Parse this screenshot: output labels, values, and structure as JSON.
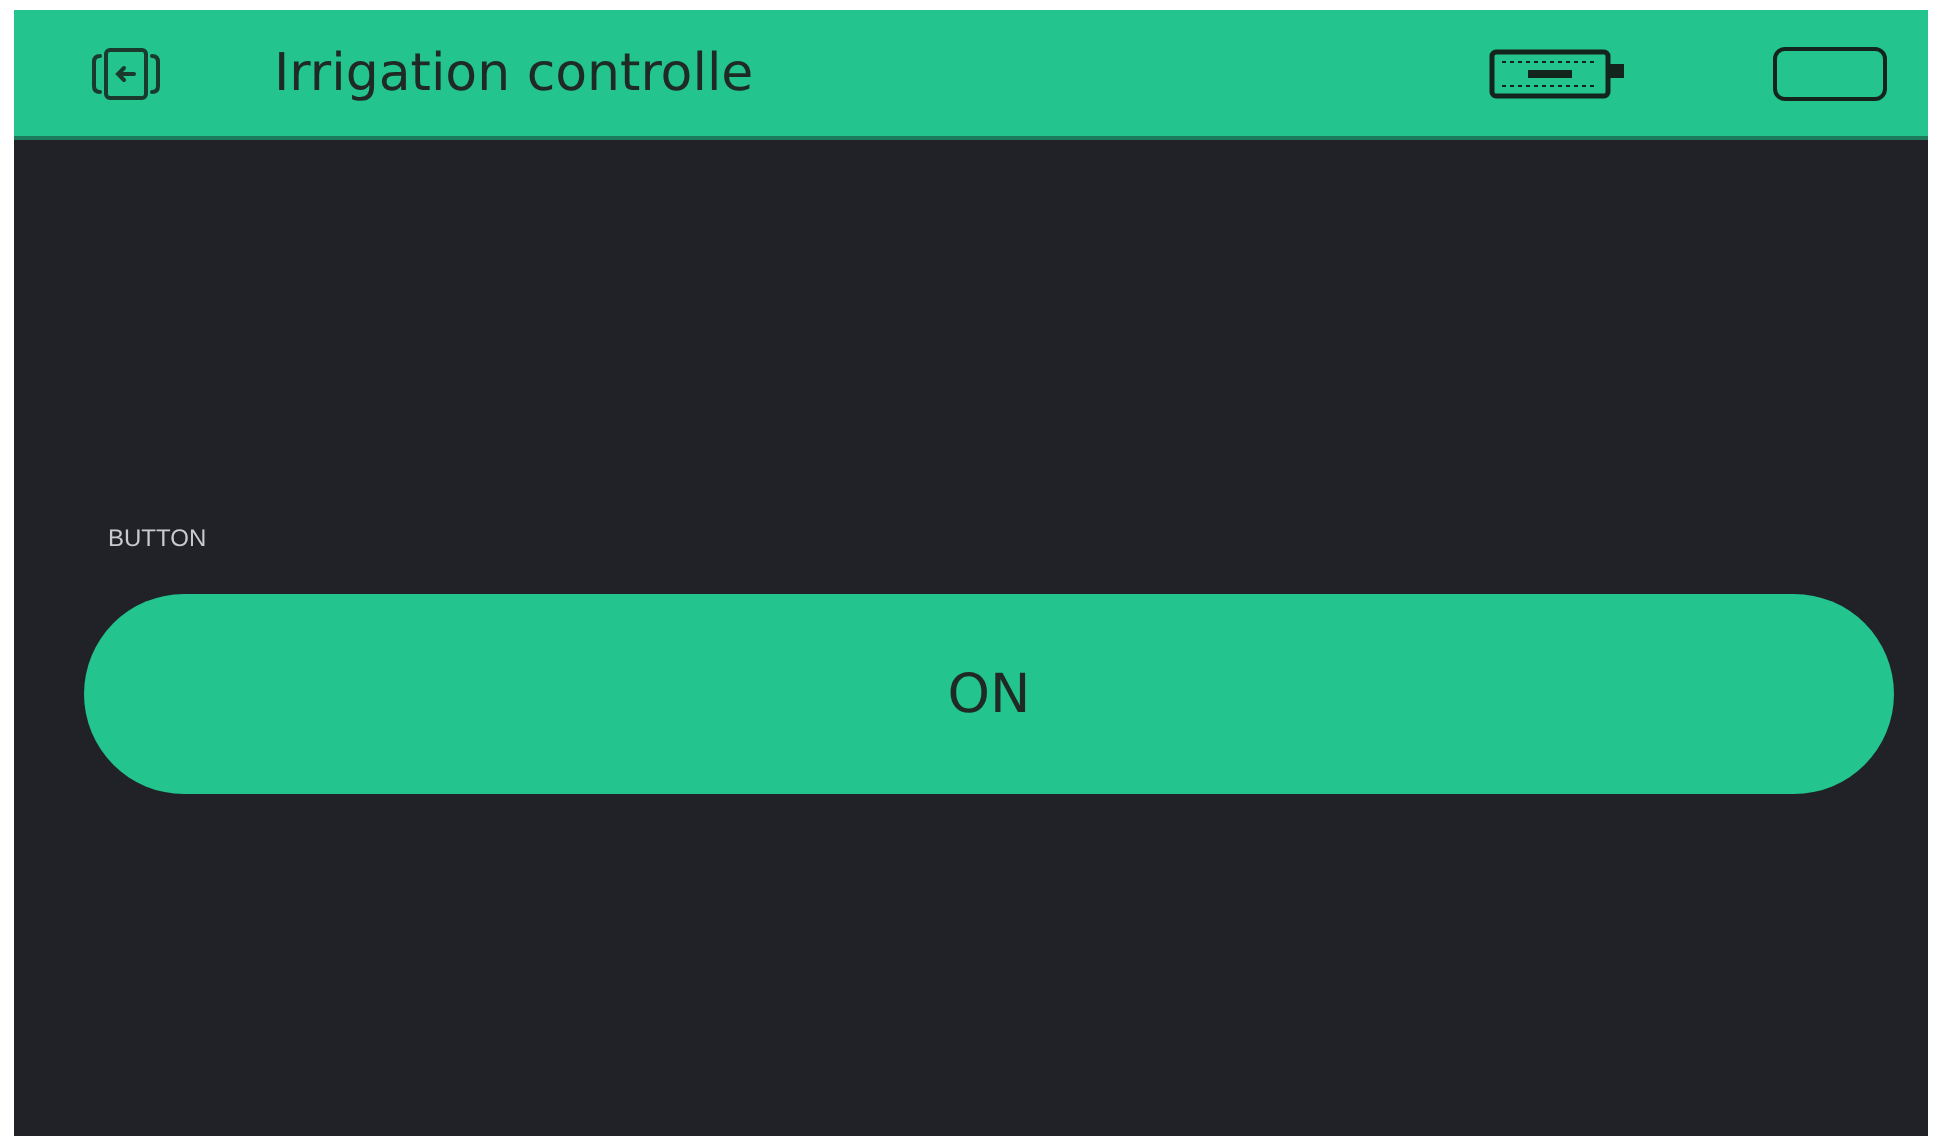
{
  "header": {
    "title": "Irrigation controlle"
  },
  "widgets": [
    {
      "kind": "button",
      "label": "BUTTON",
      "text": "ON",
      "on": true
    }
  ]
}
